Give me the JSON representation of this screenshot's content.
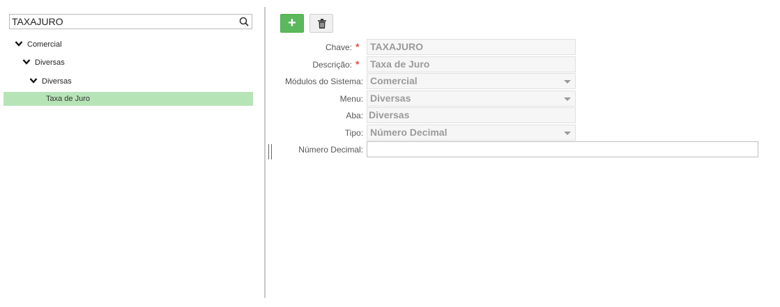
{
  "search": {
    "value": "TAXAJURO"
  },
  "tree": {
    "level1": "Comercial",
    "level2": "Diversas",
    "level3": "Diversas",
    "leaf": "Taxa de Juro"
  },
  "toolbar": {
    "add_label": "+"
  },
  "form": {
    "chave": {
      "label": "Chave:",
      "value": "TAXAJURO"
    },
    "descricao": {
      "label": "Descrição:",
      "value": "Taxa de Juro"
    },
    "modulos": {
      "label": "Módulos do Sistema:",
      "value": "Comercial"
    },
    "menu": {
      "label": "Menu:",
      "value": "Diversas"
    },
    "aba": {
      "label": "Aba:",
      "value": "Diversas"
    },
    "tipo": {
      "label": "Tipo:",
      "value": "Número Decimal"
    },
    "numero_decimal": {
      "label": "Número Decimal:",
      "value": ""
    },
    "required_mark": "*"
  },
  "colors": {
    "accent_green": "#5cb85c",
    "selected_row": "#b7e4b7",
    "required": "#d9534f"
  }
}
